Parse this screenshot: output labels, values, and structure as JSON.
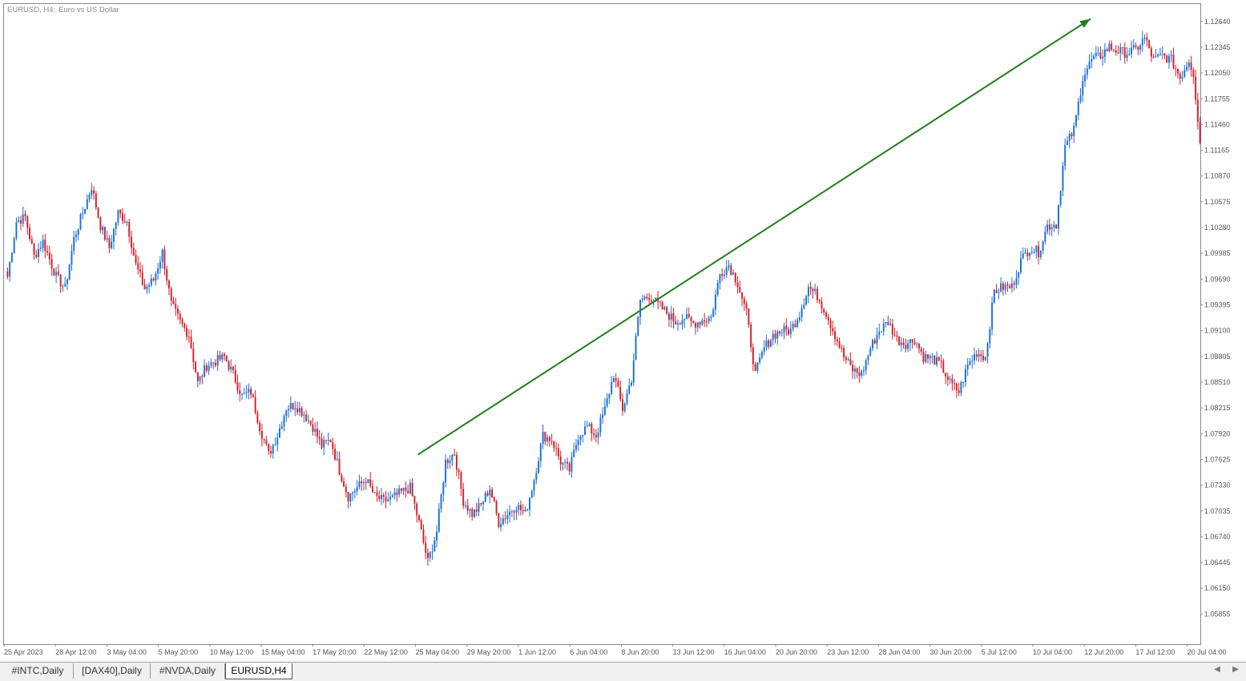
{
  "chart_header": {
    "symbol_timeframe": "EURUSD, H4:",
    "description": "Euro vs US Dollar"
  },
  "tabs": [
    {
      "label": "#INTC,Daily",
      "active": false
    },
    {
      "label": "[DAX40],Daily",
      "active": false
    },
    {
      "label": "#NVDA,Daily",
      "active": false
    },
    {
      "label": "EURUSD,H4",
      "active": true
    }
  ],
  "colors": {
    "bull": "#1a6fd6",
    "bear": "#d11f2a",
    "arrow": "#1e7d1e",
    "axis_text": "#555555"
  },
  "chart_data": {
    "type": "candlestick",
    "symbol": "EURUSD",
    "timeframe": "H4",
    "y_ticks": [
      "1.12640",
      "1.12345",
      "1.12050",
      "1.11755",
      "1.11460",
      "1.11165",
      "1.10870",
      "1.10575",
      "1.10280",
      "1.09985",
      "1.09690",
      "1.09395",
      "1.09100",
      "1.08805",
      "1.08510",
      "1.08215",
      "1.07920",
      "1.07625",
      "1.07330",
      "1.07035",
      "1.06740",
      "1.06445",
      "1.06150",
      "1.05855"
    ],
    "ylim": [
      1.0551,
      1.1284
    ],
    "x_ticks": [
      "25 Apr 2023",
      "28 Apr 12:00",
      "3 May 04:00",
      "5 May 20:00",
      "10 May 12:00",
      "15 May 04:00",
      "17 May 20:00",
      "22 May 12:00",
      "25 May 04:00",
      "29 May 20:00",
      "1 Jun 12:00",
      "6 Jun 04:00",
      "8 Jun 20:00",
      "13 Jun 12:00",
      "16 Jun 04:00",
      "20 Jun 20:00",
      "23 Jun 12:00",
      "28 Jun 04:00",
      "30 Jun 20:00",
      "5 Jul 12:00",
      "10 Jul 04:00",
      "12 Jul 20:00",
      "17 Jul 12:00",
      "20 Jul 04:00"
    ],
    "anchors": [
      [
        0,
        1.0972
      ],
      [
        4,
        1.1035
      ],
      [
        8,
        1.104
      ],
      [
        12,
        1.0995
      ],
      [
        16,
        1.1012
      ],
      [
        22,
        1.0972
      ],
      [
        26,
        1.0958
      ],
      [
        30,
        1.1015
      ],
      [
        34,
        1.1045
      ],
      [
        38,
        1.1075
      ],
      [
        42,
        1.103
      ],
      [
        46,
        1.1005
      ],
      [
        50,
        1.1045
      ],
      [
        54,
        1.1035
      ],
      [
        58,
        1.0985
      ],
      [
        62,
        1.0958
      ],
      [
        66,
        1.0968
      ],
      [
        70,
        1.1
      ],
      [
        74,
        1.094
      ],
      [
        78,
        1.092
      ],
      [
        82,
        1.0905
      ],
      [
        86,
        1.085
      ],
      [
        90,
        1.087
      ],
      [
        94,
        1.0875
      ],
      [
        98,
        1.088
      ],
      [
        102,
        1.086
      ],
      [
        106,
        1.0835
      ],
      [
        110,
        1.084
      ],
      [
        114,
        1.08
      ],
      [
        118,
        1.0768
      ],
      [
        122,
        1.079
      ],
      [
        126,
        1.0822
      ],
      [
        130,
        1.0825
      ],
      [
        134,
        1.0815
      ],
      [
        138,
        1.08
      ],
      [
        142,
        1.0778
      ],
      [
        146,
        1.0785
      ],
      [
        150,
        1.075
      ],
      [
        154,
        1.072
      ],
      [
        158,
        1.073
      ],
      [
        162,
        1.074
      ],
      [
        166,
        1.072
      ],
      [
        170,
        1.0715
      ],
      [
        174,
        1.0718
      ],
      [
        178,
        1.0725
      ],
      [
        182,
        1.073
      ],
      [
        186,
        1.069
      ],
      [
        190,
        1.0645
      ],
      [
        194,
        1.068
      ],
      [
        198,
        1.076
      ],
      [
        202,
        1.077
      ],
      [
        206,
        1.0715
      ],
      [
        210,
        1.07
      ],
      [
        214,
        1.071
      ],
      [
        218,
        1.073
      ],
      [
        222,
        1.069
      ],
      [
        226,
        1.07
      ],
      [
        230,
        1.071
      ],
      [
        234,
        1.07
      ],
      [
        238,
        1.074
      ],
      [
        242,
        1.079
      ],
      [
        246,
        1.0785
      ],
      [
        250,
        1.076
      ],
      [
        254,
        1.075
      ],
      [
        258,
        1.079
      ],
      [
        262,
        1.08
      ],
      [
        266,
        1.079
      ],
      [
        270,
        1.082
      ],
      [
        274,
        1.086
      ],
      [
        278,
        1.082
      ],
      [
        282,
        1.0855
      ],
      [
        286,
        1.0945
      ],
      [
        290,
        1.095
      ],
      [
        294,
        1.094
      ],
      [
        298,
        1.093
      ],
      [
        302,
        1.092
      ],
      [
        306,
        1.0925
      ],
      [
        310,
        1.0918
      ],
      [
        314,
        1.0922
      ],
      [
        318,
        1.0925
      ],
      [
        322,
        1.0975
      ],
      [
        326,
        1.0985
      ],
      [
        330,
        1.0965
      ],
      [
        334,
        1.093
      ],
      [
        338,
        1.086
      ],
      [
        342,
        1.089
      ],
      [
        346,
        1.0905
      ],
      [
        350,
        1.091
      ],
      [
        354,
        1.091
      ],
      [
        358,
        1.093
      ],
      [
        362,
        1.096
      ],
      [
        366,
        1.095
      ],
      [
        370,
        1.093
      ],
      [
        374,
        1.0905
      ],
      [
        378,
        1.088
      ],
      [
        382,
        1.0865
      ],
      [
        386,
        1.086
      ],
      [
        390,
        1.089
      ],
      [
        394,
        1.091
      ],
      [
        398,
        1.092
      ],
      [
        402,
        1.09
      ],
      [
        406,
        1.0895
      ],
      [
        410,
        1.09
      ],
      [
        414,
        1.088
      ],
      [
        418,
        1.0878
      ],
      [
        422,
        1.087
      ],
      [
        426,
        1.085
      ],
      [
        430,
        1.084
      ],
      [
        434,
        1.087
      ],
      [
        438,
        1.0885
      ],
      [
        442,
        1.088
      ],
      [
        446,
        1.0955
      ],
      [
        450,
        1.096
      ],
      [
        454,
        1.096
      ],
      [
        458,
        1.099
      ],
      [
        462,
        1.1005
      ],
      [
        466,
        1.1
      ],
      [
        470,
        1.103
      ],
      [
        474,
        1.1032
      ],
      [
        478,
        1.112
      ],
      [
        482,
        1.114
      ],
      [
        486,
        1.12
      ],
      [
        490,
        1.122
      ],
      [
        494,
        1.1225
      ],
      [
        498,
        1.1235
      ],
      [
        502,
        1.123
      ],
      [
        506,
        1.1228
      ],
      [
        510,
        1.1232
      ],
      [
        514,
        1.1245
      ],
      [
        518,
        1.122
      ],
      [
        522,
        1.1225
      ],
      [
        526,
        1.122
      ],
      [
        530,
        1.12
      ],
      [
        534,
        1.122
      ],
      [
        536,
        1.1205
      ],
      [
        539,
        1.1125
      ]
    ],
    "grid": false,
    "annotation": {
      "type": "trend-arrow",
      "from": {
        "bar": 186,
        "price": 1.0768
      },
      "to": {
        "bar": 490,
        "price": 1.1267
      },
      "direction": "up"
    }
  }
}
